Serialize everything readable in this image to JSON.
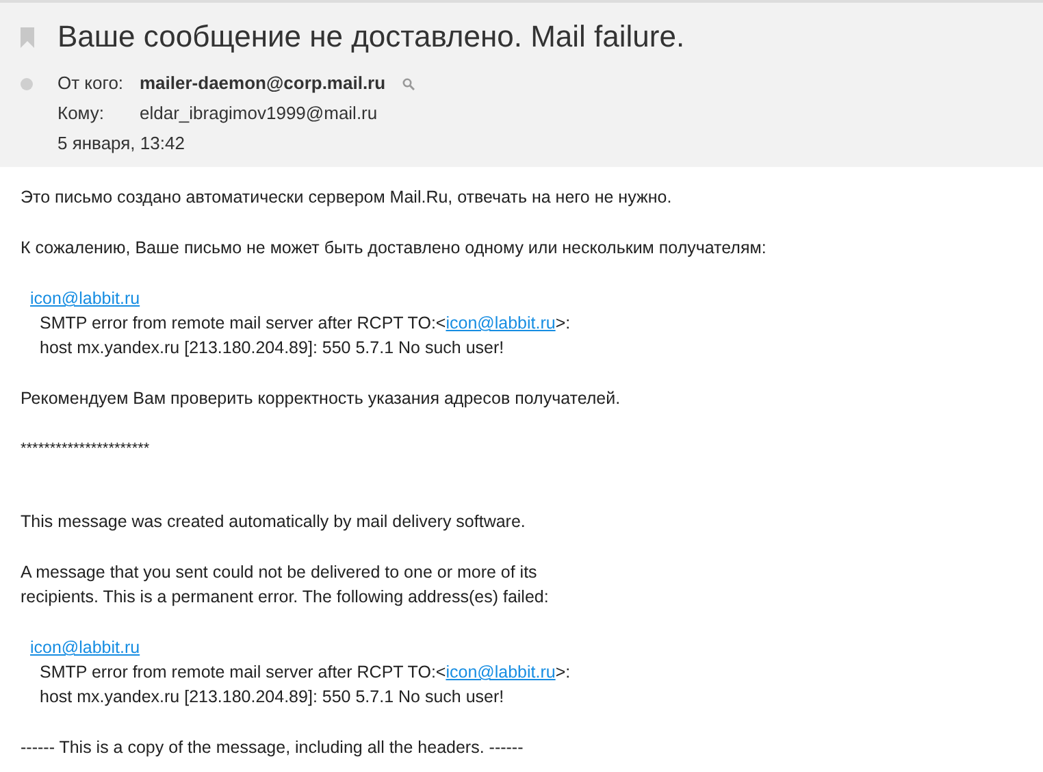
{
  "header": {
    "subject": "Ваше сообщение не доставлено. Mail failure.",
    "flagged": false,
    "unread": false,
    "from_label": "От кого:",
    "from": "mailer-daemon@corp.mail.ru",
    "to_label": "Кому:",
    "to": "eldar_ibragimov1999@mail.ru",
    "date": "5 января, 13:42"
  },
  "body": [
    {
      "kind": "paragraph",
      "lines": [
        "Это письмо создано автоматически сервером Mail.Ru, отвечать на него не нужно."
      ]
    },
    {
      "kind": "paragraph",
      "lines": [
        "К сожалению, Ваше письмо не может быть доставлено одному или нескольким получателям:"
      ]
    },
    {
      "kind": "failure",
      "address": "icon@labbit.ru",
      "error_prefix": "SMTP error from remote mail server after RCPT TO:<",
      "error_link": "icon@labbit.ru",
      "error_suffix": ">:",
      "host": "host mx.yandex.ru [213.180.204.89]: 550 5.7.1 No such user!"
    },
    {
      "kind": "paragraph",
      "lines": [
        "Рекомендуем Вам проверить корректность указания адресов получателей."
      ]
    },
    {
      "kind": "separator",
      "text": "**********************"
    },
    {
      "kind": "paragraph",
      "lines": [
        "This message was created automatically by mail delivery software."
      ]
    },
    {
      "kind": "paragraph",
      "lines": [
        "A message that you sent could not be delivered to one or more of its",
        "recipients. This is a permanent error. The following address(es) failed:"
      ]
    },
    {
      "kind": "failure",
      "address": "icon@labbit.ru",
      "error_prefix": "SMTP error from remote mail server after RCPT TO:<",
      "error_link": "icon@labbit.ru",
      "error_suffix": ">:",
      "host": "host mx.yandex.ru [213.180.204.89]: 550 5.7.1 No such user!"
    },
    {
      "kind": "paragraph",
      "lines": [
        "------ This is a copy of the message, including all the headers. ------"
      ]
    }
  ]
}
